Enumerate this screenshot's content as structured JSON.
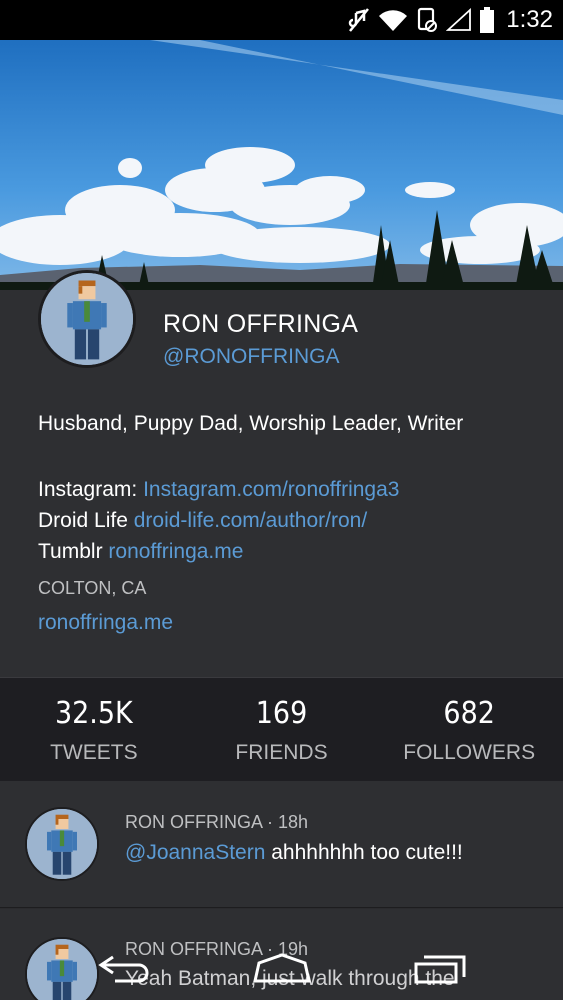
{
  "status_bar": {
    "time": "1:32",
    "icons": [
      "mute-icon",
      "wifi-icon",
      "nfc-icon",
      "signal-icon",
      "battery-icon"
    ]
  },
  "profile": {
    "name": "RON OFFRINGA",
    "handle": "@RONOFFRINGA",
    "bio": "Husband, Puppy Dad, Worship Leader, Writer",
    "links": [
      {
        "label": "Instagram:",
        "url": "Instagram.com/ronoffringa3"
      },
      {
        "label": "Droid Life",
        "url": "droid-life.com/author/ron/"
      },
      {
        "label": "Tumblr",
        "url": "ronoffringa.me"
      }
    ],
    "location": "COLTON, CA",
    "website": "ronoffringa.me"
  },
  "stats": [
    {
      "count": "32.5K",
      "label": "TWEETS"
    },
    {
      "count": "169",
      "label": "FRIENDS"
    },
    {
      "count": "682",
      "label": "FOLLOWERS"
    }
  ],
  "tweets": [
    {
      "author": "RON OFFRINGA",
      "time": "18h",
      "mention": "@JoannaStern",
      "text": " ahhhhhhh too cute!!!"
    },
    {
      "author": "RON OFFRINGA",
      "time": "19h",
      "mention": "",
      "text": "Yeah Batman, just walk through the"
    }
  ],
  "colors": {
    "link": "#5b9bd5",
    "background": "#2e2f32",
    "stats_background": "#1e1e22"
  }
}
